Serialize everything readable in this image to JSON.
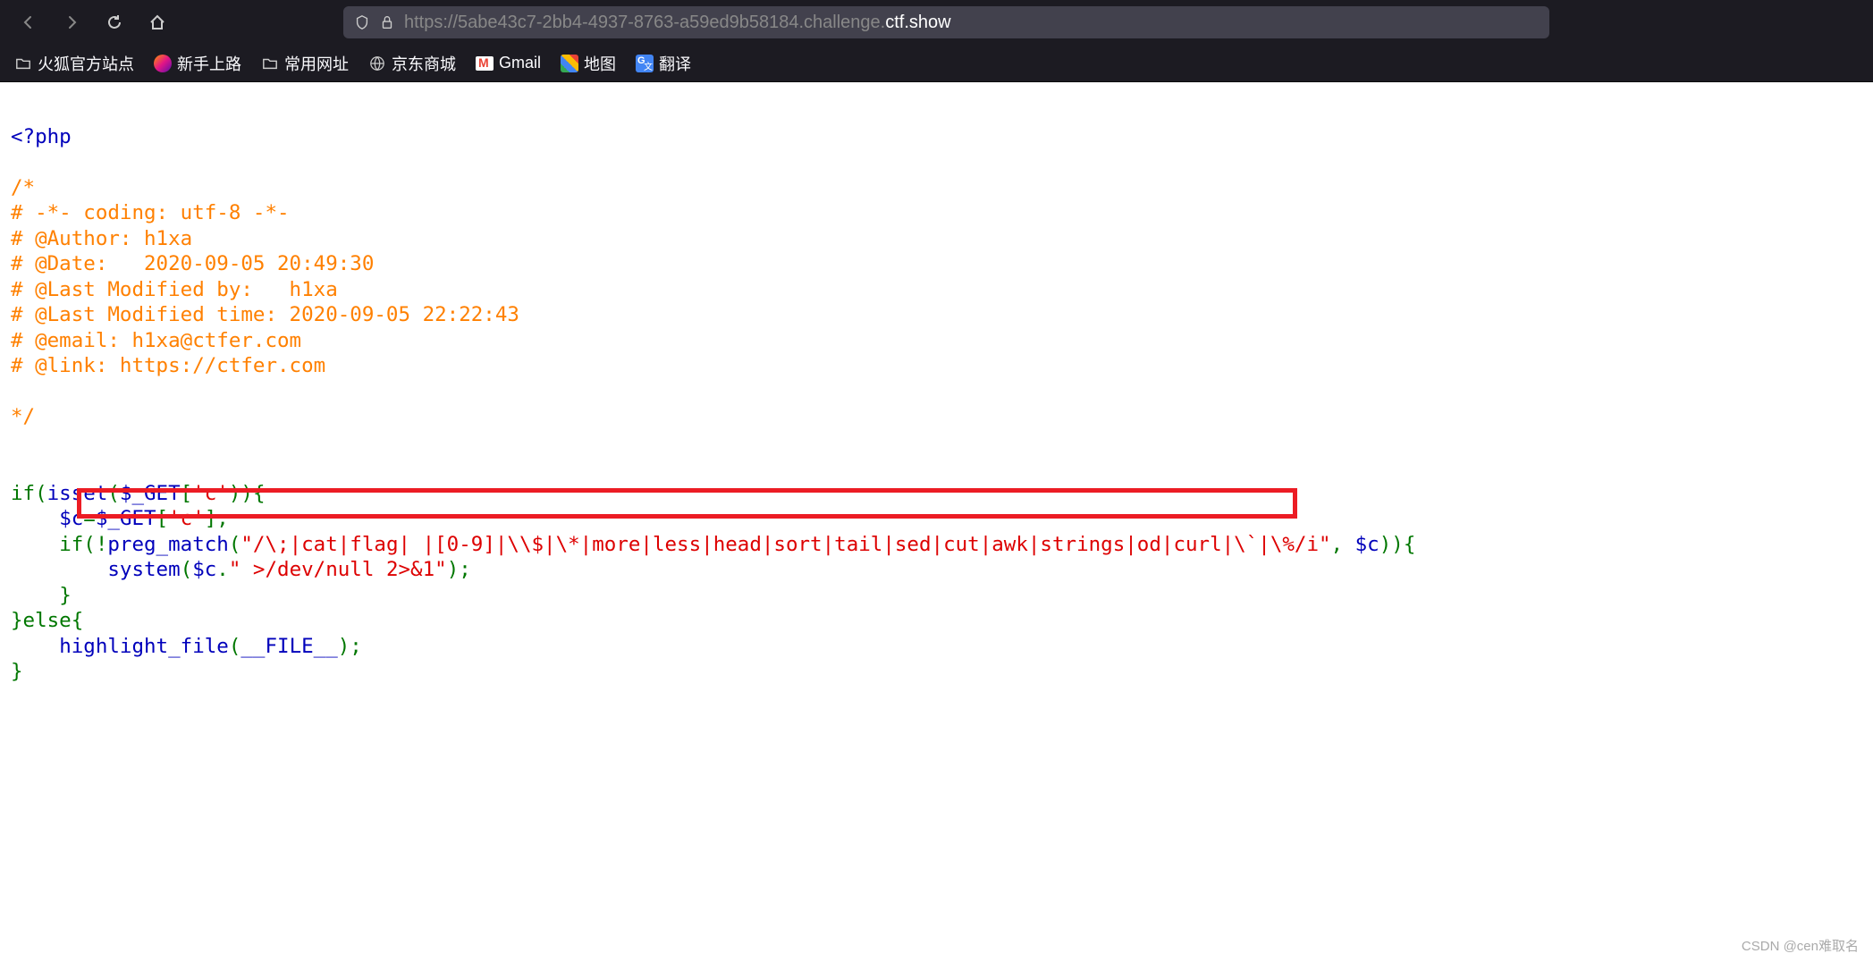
{
  "browser": {
    "url_prefix": "https://",
    "url_host_dim": "5abe43c7-2bb4-4937-8763-a59ed9b58184.challenge.",
    "url_host_bright": "ctf.show"
  },
  "bookmarks": [
    {
      "label": "火狐官方站点",
      "icon": "folder"
    },
    {
      "label": "新手上路",
      "icon": "firefox"
    },
    {
      "label": "常用网址",
      "icon": "folder"
    },
    {
      "label": "京东商城",
      "icon": "globe"
    },
    {
      "label": "Gmail",
      "icon": "gmail"
    },
    {
      "label": "地图",
      "icon": "maps"
    },
    {
      "label": "翻译",
      "icon": "translate"
    }
  ],
  "code": {
    "php_open": "<?php",
    "comment_open": "/*",
    "c1": "# -*- coding: utf-8 -*-",
    "c2": "# @Author: h1xa",
    "c3": "# @Date:   2020-09-05 20:49:30",
    "c4": "# @Last Modified by:   h1xa",
    "c5": "# @Last Modified time: 2020-09-05 22:22:43",
    "c6": "# @email: h1xa@ctfer.com",
    "c7": "# @link: https://ctfer.com",
    "comment_close": "*/",
    "line_if": "if(",
    "isset": "isset",
    "lp": "(",
    "get": "$_GET",
    "idx_open": "[",
    "str_c": "'c'",
    "idx_close": "]",
    "rp": "))",
    "brace_open": "{",
    "indent1": "    ",
    "indent2": "        ",
    "c_assign_1": "$c",
    "eq": "=",
    "get2": "$_GET",
    "end_stmt": "];",
    "if2": "if(!",
    "preg": "preg_match",
    "regex": "\"/\\;|cat|flag| |[0-9]|\\\\$|\\*|more|less|head|sort|tail|sed|cut|awk|strings|od|curl|\\`|\\%/i\"",
    "comma": ", ",
    "dollar_c": "$c",
    "rp2": ")){",
    "system": "system",
    "dot": ".",
    "redirect": "\" >/dev/null 2>&1\"",
    "rp_semi": ");",
    "brace_close": "}",
    "else": "else",
    "highlight": "highlight_file",
    "magic_file": "__FILE__",
    "rp_semi2": ");"
  },
  "watermark": "CSDN @cen难取名"
}
